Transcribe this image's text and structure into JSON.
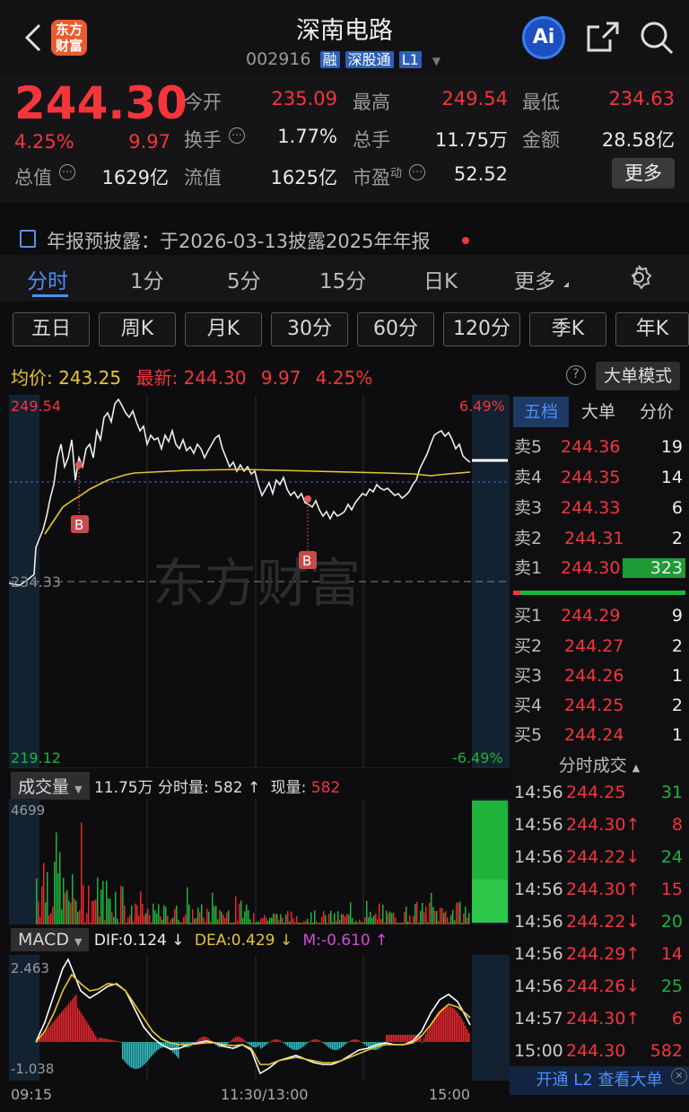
{
  "header": {
    "stock_name": "深南电路",
    "stock_code": "002916",
    "badges": [
      "融",
      "深股通",
      "L1"
    ],
    "logo_text_top": "东方",
    "logo_text_bottom": "财富",
    "ai_label": "Ai"
  },
  "quote": {
    "price": "244.30",
    "change_pct": "4.25%",
    "change": "9.97",
    "open_label": "今开",
    "open": "235.09",
    "high_label": "最高",
    "high": "249.54",
    "low_label": "最低",
    "low": "234.63",
    "turnover_label": "换手",
    "turnover": "1.77%",
    "volume_label": "总手",
    "volume": "11.75万",
    "amount_label": "金额",
    "amount": "28.58亿",
    "mktcap_label": "总值",
    "mktcap": "1629亿",
    "float_label": "流值",
    "float": "1625亿",
    "pe_label": "市盈",
    "pe_sup": "动",
    "pe": "52.52",
    "more_label": "更多"
  },
  "notice": {
    "text": "年报预披露：于2026-03-13披露2025年年报"
  },
  "tabs": [
    "分时",
    "1分",
    "5分",
    "15分",
    "日K",
    "更多"
  ],
  "ktabs": [
    "五日",
    "周K",
    "月K",
    "30分",
    "60分",
    "120分",
    "季K",
    "年K"
  ],
  "info": {
    "avg_label": "均价:",
    "avg": "243.25",
    "latest_label": "最新:",
    "latest": "244.30",
    "chg": "9.97",
    "pct": "4.25%",
    "bigorder": "大单模式"
  },
  "chart": {
    "max": "249.54",
    "min": "219.12",
    "mid": "234.33",
    "max_pct": "6.49%",
    "min_pct": "-6.49%",
    "watermark": "东方财富",
    "b1": "B",
    "b2": "B"
  },
  "volume": {
    "title": "成交量",
    "total": "11.75万",
    "minute_label": "分时量:",
    "minute": "582",
    "now_label": "现量:",
    "now": "582",
    "axis_max": "4699"
  },
  "macd": {
    "title": "MACD",
    "dif": "DIF:0.124",
    "dea": "DEA:0.429",
    "m": "M:-0.610",
    "axis_max": "2.463",
    "axis_min": "-1.038"
  },
  "time_axis": [
    "09:15",
    "11:30/13:00",
    "15:00"
  ],
  "panel": {
    "tabs": [
      "五档",
      "大单",
      "分价"
    ],
    "asks": [
      {
        "label": "卖5",
        "price": "244.36",
        "vol": "19"
      },
      {
        "label": "卖4",
        "price": "244.35",
        "vol": "14"
      },
      {
        "label": "卖3",
        "price": "244.33",
        "vol": "6"
      },
      {
        "label": "卖2",
        "price": "244.31",
        "vol": "2"
      },
      {
        "label": "卖1",
        "price": "244.30",
        "vol": "323"
      }
    ],
    "bids": [
      {
        "label": "买1",
        "price": "244.29",
        "vol": "9"
      },
      {
        "label": "买2",
        "price": "244.27",
        "vol": "2"
      },
      {
        "label": "买3",
        "price": "244.26",
        "vol": "1"
      },
      {
        "label": "买4",
        "price": "244.25",
        "vol": "2"
      },
      {
        "label": "买5",
        "price": "244.24",
        "vol": "1"
      }
    ],
    "ticks_title": "分时成交",
    "ticks": [
      {
        "time": "14:56",
        "price": "244.25",
        "vol": "31"
      },
      {
        "time": "14:56",
        "price": "244.30↑",
        "vol": "8"
      },
      {
        "time": "14:56",
        "price": "244.22↓",
        "vol": "24"
      },
      {
        "time": "14:56",
        "price": "244.30↑",
        "vol": "15"
      },
      {
        "time": "14:56",
        "price": "244.22↓",
        "vol": "20"
      },
      {
        "time": "14:56",
        "price": "244.29↑",
        "vol": "14"
      },
      {
        "time": "14:56",
        "price": "244.26↓",
        "vol": "25"
      },
      {
        "time": "14:57",
        "price": "244.30↑",
        "vol": "6"
      },
      {
        "time": "15:00",
        "price": "244.30",
        "vol": "582"
      }
    ],
    "l2_banner": "开通 L2 查看大单"
  }
}
